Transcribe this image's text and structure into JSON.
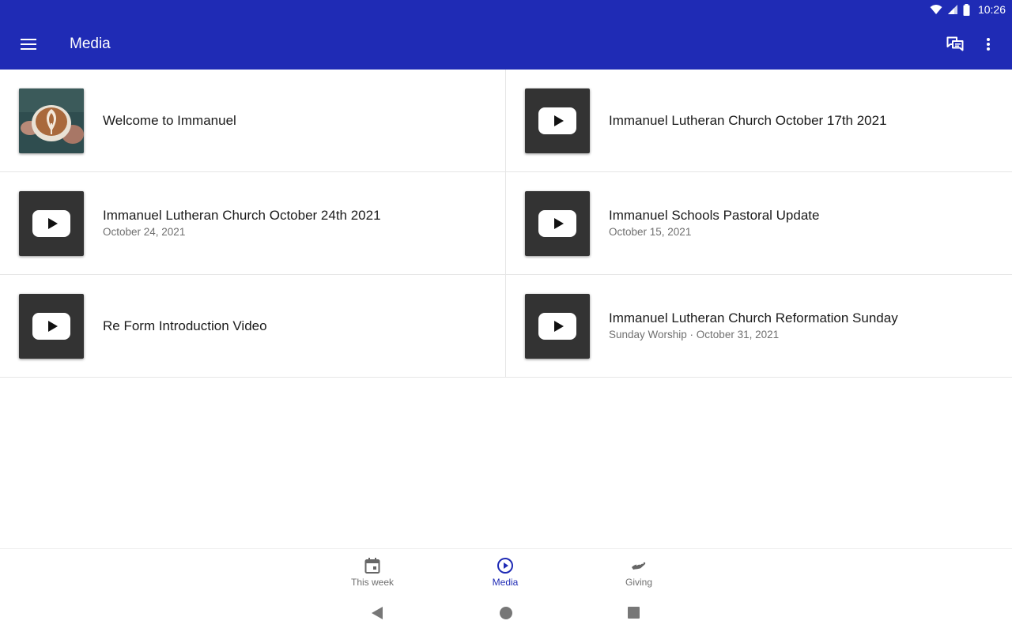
{
  "status_bar": {
    "time": "10:26"
  },
  "app_bar": {
    "title": "Media"
  },
  "media_items": [
    {
      "title": "Welcome to Immanuel",
      "subtitle": "",
      "thumbnail": "photo"
    },
    {
      "title": "Immanuel Lutheran Church October 17th 2021",
      "subtitle": "",
      "thumbnail": "youtube"
    },
    {
      "title": "Immanuel Lutheran Church October 24th 2021",
      "subtitle": "October 24, 2021",
      "thumbnail": "youtube"
    },
    {
      "title": "Immanuel Schools Pastoral Update",
      "subtitle": "October 15, 2021",
      "thumbnail": "youtube"
    },
    {
      "title": "Re Form Introduction Video",
      "subtitle": "",
      "thumbnail": "youtube"
    },
    {
      "title": "Immanuel Lutheran Church Reformation Sunday",
      "subtitle": "Sunday Worship · October 31, 2021",
      "thumbnail": "youtube"
    }
  ],
  "bottom_nav": {
    "items": [
      {
        "label": "This week",
        "icon": "calendar-icon",
        "active": false
      },
      {
        "label": "Media",
        "icon": "play-circle-icon",
        "active": true
      },
      {
        "label": "Giving",
        "icon": "giving-hand-icon",
        "active": false
      }
    ]
  },
  "colors": {
    "primary": "#1f2bb5",
    "thumb_bg": "#333333",
    "secondary_text": "#6f6f6f"
  }
}
